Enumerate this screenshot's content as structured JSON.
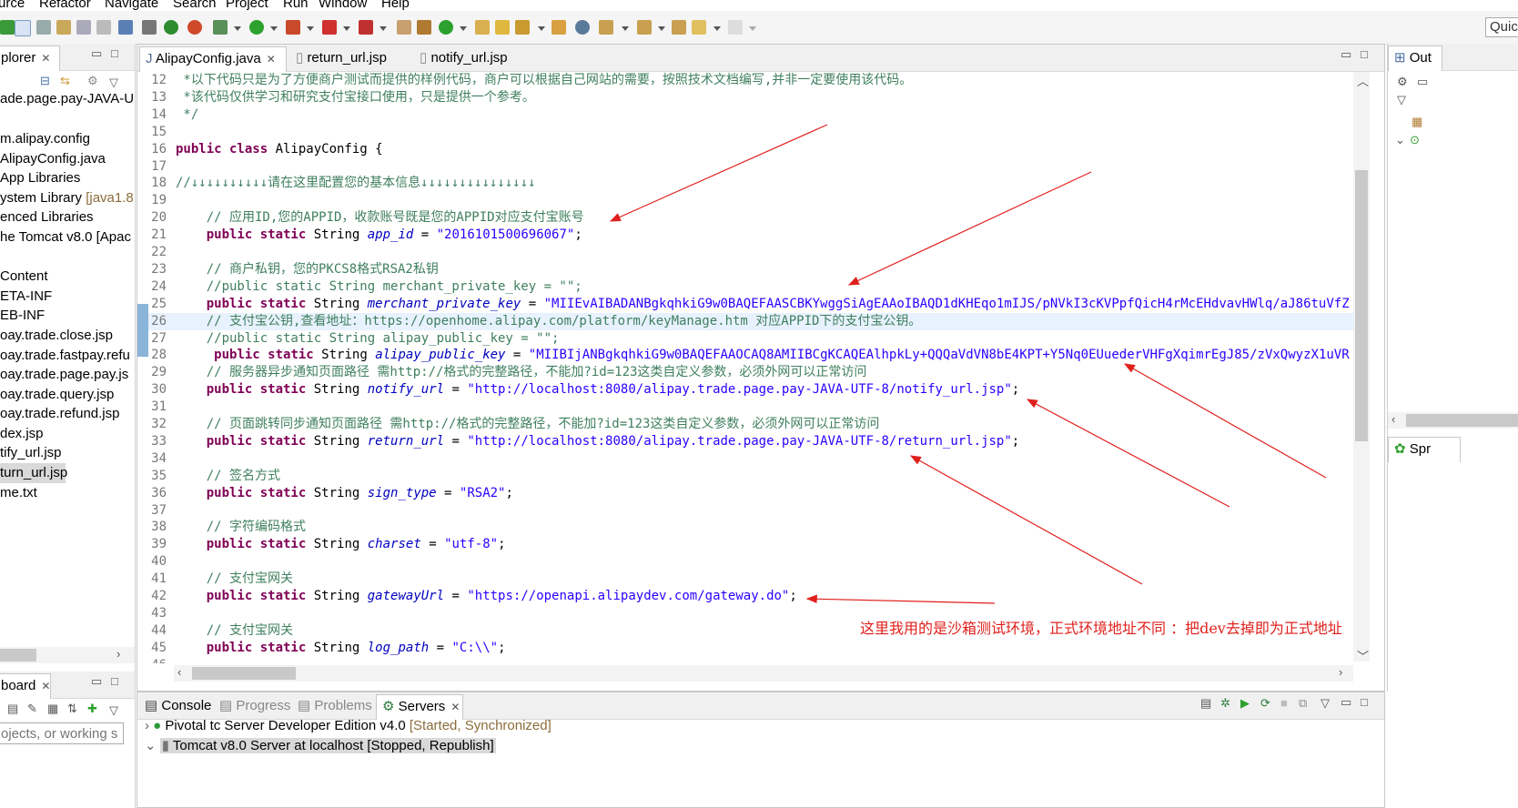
{
  "menu": [
    "urce",
    "Refactor",
    "Navigate",
    "Search",
    "Project",
    "Run",
    "Window",
    "Help"
  ],
  "toolbar": {
    "quick_access": "Quic"
  },
  "explorer": {
    "tab_label": "plorer",
    "items": [
      {
        "label": "ade.page.pay-JAVA-U",
        "decoration": ""
      },
      {
        "label": "m.alipay.config",
        "decoration": ""
      },
      {
        "label": "AlipayConfig.java",
        "decoration": ""
      },
      {
        "label": "App Libraries",
        "decoration": ""
      },
      {
        "label": "ystem Library",
        "decoration": " [java1.8"
      },
      {
        "label": "enced Libraries",
        "decoration": ""
      },
      {
        "label": "he Tomcat v8.0 [Apac",
        "decoration": ""
      },
      {
        "label": "Content",
        "decoration": ""
      },
      {
        "label": "ETA-INF",
        "decoration": ""
      },
      {
        "label": "EB-INF",
        "decoration": ""
      },
      {
        "label": "oay.trade.close.jsp",
        "decoration": ""
      },
      {
        "label": "oay.trade.fastpay.refu",
        "decoration": ""
      },
      {
        "label": "oay.trade.page.pay.js",
        "decoration": ""
      },
      {
        "label": "oay.trade.query.jsp",
        "decoration": ""
      },
      {
        "label": "oay.trade.refund.jsp",
        "decoration": ""
      },
      {
        "label": "dex.jsp",
        "decoration": ""
      },
      {
        "label": "tify_url.jsp",
        "decoration": ""
      },
      {
        "label": "turn_url.jsp",
        "decoration": ""
      },
      {
        "label": "me.txt",
        "decoration": ""
      }
    ]
  },
  "dashboard": {
    "tab_label": "board",
    "search_placeholder": "ojects, or working s"
  },
  "editor": {
    "tabs": [
      {
        "label": "AlipayConfig.java",
        "active": true
      },
      {
        "label": "return_url.jsp",
        "active": false
      },
      {
        "label": "notify_url.jsp",
        "active": false
      }
    ],
    "lines": [
      {
        "n": "12",
        "parts": [
          {
            "t": "cm",
            "s": " *以下代码只是为了方便商户测试而提供的样例代码，商户可以根据自己网站的需要，按照技术文档编写,并非一定要使用该代码。"
          }
        ]
      },
      {
        "n": "13",
        "parts": [
          {
            "t": "cm",
            "s": " *该代码仅供学习和研究支付宝接口使用，只是提供一个参考。"
          }
        ]
      },
      {
        "n": "14",
        "parts": [
          {
            "t": "cm",
            "s": " */"
          }
        ]
      },
      {
        "n": "15",
        "parts": []
      },
      {
        "n": "16",
        "parts": [
          {
            "t": "kw",
            "s": "public class "
          },
          {
            "t": "",
            "s": "AlipayConfig {"
          }
        ]
      },
      {
        "n": "17",
        "parts": []
      },
      {
        "n": "18",
        "parts": [
          {
            "t": "cm",
            "s": "//↓↓↓↓↓↓↓↓↓↓请在这里配置您的基本信息↓↓↓↓↓↓↓↓↓↓↓↓↓↓↓"
          }
        ]
      },
      {
        "n": "19",
        "parts": []
      },
      {
        "n": "20",
        "parts": [
          {
            "t": "cm",
            "s": "    // 应用ID,您的APPID，收款账号既是您的APPID对应支付宝账号"
          }
        ]
      },
      {
        "n": "21",
        "parts": [
          {
            "t": "",
            "s": "    "
          },
          {
            "t": "kw",
            "s": "public static "
          },
          {
            "t": "",
            "s": "String "
          },
          {
            "t": "fld",
            "s": "app_id"
          },
          {
            "t": "",
            "s": " = "
          },
          {
            "t": "st",
            "s": "\"2016101500696067\""
          },
          {
            "t": "",
            "s": ";"
          }
        ]
      },
      {
        "n": "22",
        "parts": []
      },
      {
        "n": "23",
        "parts": [
          {
            "t": "cm",
            "s": "    // 商户私钥，您的PKCS8格式RSA2私钥"
          }
        ]
      },
      {
        "n": "24",
        "parts": [
          {
            "t": "cm",
            "s": "    //public static String merchant_private_key = \"\";"
          }
        ]
      },
      {
        "n": "25",
        "parts": [
          {
            "t": "",
            "s": "    "
          },
          {
            "t": "kw",
            "s": "public static "
          },
          {
            "t": "",
            "s": "String "
          },
          {
            "t": "fld",
            "s": "merchant_private_key"
          },
          {
            "t": "",
            "s": " = "
          },
          {
            "t": "st",
            "s": "\"MIIEvAIBADANBgkqhkiG9w0BAQEFAASCBKYwggSiAgEAAoIBAQD1dKHEqo1mIJS/pNVkI3cKVPpfQicH4rMcEHdvavHWlq/aJ86tuVfZ"
          }
        ]
      },
      {
        "n": "26",
        "parts": [
          {
            "t": "cm",
            "s": "    // 支付宝公钥,查看地址：https://openhome.alipay.com/platform/keyManage.htm 对应APPID下的支付宝公钥。"
          }
        ]
      },
      {
        "n": "27",
        "parts": [
          {
            "t": "cm",
            "s": "    //public static String alipay_public_key = \"\";"
          }
        ]
      },
      {
        "n": "28",
        "parts": [
          {
            "t": "",
            "s": "     "
          },
          {
            "t": "kw",
            "s": "public static "
          },
          {
            "t": "",
            "s": "String "
          },
          {
            "t": "fld",
            "s": "alipay_public_key"
          },
          {
            "t": "",
            "s": " = "
          },
          {
            "t": "st",
            "s": "\"MIIBIjANBgkqhkiG9w0BAQEFAAOCAQ8AMIIBCgKCAQEAlhpkLy+QQQaVdVN8bE4KPT+Y5Nq0EUuederVHFgXqimrEgJ85/zVxQwyzX1uVR"
          }
        ]
      },
      {
        "n": "29",
        "parts": [
          {
            "t": "cm",
            "s": "    // 服务器异步通知页面路径 需http://格式的完整路径，不能加?id=123这类自定义参数，必须外网可以正常访问"
          }
        ]
      },
      {
        "n": "30",
        "parts": [
          {
            "t": "",
            "s": "    "
          },
          {
            "t": "kw",
            "s": "public static "
          },
          {
            "t": "",
            "s": "String "
          },
          {
            "t": "fld",
            "s": "notify_url"
          },
          {
            "t": "",
            "s": " = "
          },
          {
            "t": "st",
            "s": "\"http://localhost:8080/alipay.trade.page.pay-JAVA-UTF-8/notify_url.jsp\""
          },
          {
            "t": "",
            "s": ";"
          }
        ]
      },
      {
        "n": "31",
        "parts": []
      },
      {
        "n": "32",
        "parts": [
          {
            "t": "cm",
            "s": "    // 页面跳转同步通知页面路径 需http://格式的完整路径，不能加?id=123这类自定义参数，必须外网可以正常访问"
          }
        ]
      },
      {
        "n": "33",
        "parts": [
          {
            "t": "",
            "s": "    "
          },
          {
            "t": "kw",
            "s": "public static "
          },
          {
            "t": "",
            "s": "String "
          },
          {
            "t": "fld",
            "s": "return_url"
          },
          {
            "t": "",
            "s": " = "
          },
          {
            "t": "st",
            "s": "\"http://localhost:8080/alipay.trade.page.pay-JAVA-UTF-8/return_url.jsp\""
          },
          {
            "t": "",
            "s": ";"
          }
        ]
      },
      {
        "n": "34",
        "parts": []
      },
      {
        "n": "35",
        "parts": [
          {
            "t": "cm",
            "s": "    // 签名方式"
          }
        ]
      },
      {
        "n": "36",
        "parts": [
          {
            "t": "",
            "s": "    "
          },
          {
            "t": "kw",
            "s": "public static "
          },
          {
            "t": "",
            "s": "String "
          },
          {
            "t": "fld",
            "s": "sign_type"
          },
          {
            "t": "",
            "s": " = "
          },
          {
            "t": "st",
            "s": "\"RSA2\""
          },
          {
            "t": "",
            "s": ";"
          }
        ]
      },
      {
        "n": "37",
        "parts": []
      },
      {
        "n": "38",
        "parts": [
          {
            "t": "cm",
            "s": "    // 字符编码格式"
          }
        ]
      },
      {
        "n": "39",
        "parts": [
          {
            "t": "",
            "s": "    "
          },
          {
            "t": "kw",
            "s": "public static "
          },
          {
            "t": "",
            "s": "String "
          },
          {
            "t": "fld",
            "s": "charset"
          },
          {
            "t": "",
            "s": " = "
          },
          {
            "t": "st",
            "s": "\"utf-8\""
          },
          {
            "t": "",
            "s": ";"
          }
        ]
      },
      {
        "n": "40",
        "parts": []
      },
      {
        "n": "41",
        "parts": [
          {
            "t": "cm",
            "s": "    // 支付宝网关"
          }
        ]
      },
      {
        "n": "42",
        "parts": [
          {
            "t": "",
            "s": "    "
          },
          {
            "t": "kw",
            "s": "public static "
          },
          {
            "t": "",
            "s": "String "
          },
          {
            "t": "fld",
            "s": "gatewayUrl"
          },
          {
            "t": "",
            "s": " = "
          },
          {
            "t": "st",
            "s": "\"https://openapi.alipaydev.com/gateway.do\""
          },
          {
            "t": "",
            "s": ";"
          }
        ]
      },
      {
        "n": "43",
        "parts": []
      },
      {
        "n": "44",
        "parts": [
          {
            "t": "cm",
            "s": "    // 支付宝网关"
          }
        ]
      },
      {
        "n": "45",
        "parts": [
          {
            "t": "",
            "s": "    "
          },
          {
            "t": "kw",
            "s": "public static "
          },
          {
            "t": "",
            "s": "String "
          },
          {
            "t": "fld",
            "s": "log_path"
          },
          {
            "t": "",
            "s": " = "
          },
          {
            "t": "st",
            "s": "\"C:\\\\\""
          },
          {
            "t": "",
            "s": ";"
          }
        ]
      },
      {
        "n": "46",
        "parts": []
      }
    ],
    "annotation": "这里我用的是沙箱测试环境，正式环境地址不同 ：把dev去掉即为正式地址"
  },
  "outline": {
    "tab_label": "Out",
    "spring_label": "Spr"
  },
  "bottom": {
    "tabs": [
      "Console",
      "Progress",
      "Problems",
      "Servers"
    ],
    "servers": [
      {
        "name": "Pivotal tc Server Developer Edition v4.0",
        "status": " [Started, Synchronized]",
        "expanded": false,
        "selected": false
      },
      {
        "name": "Tomcat v8.0 Server at localhost",
        "status": " [Stopped, Republish]",
        "expanded": true,
        "selected": true
      }
    ]
  },
  "colors": {
    "keyword": "#7f0055",
    "comment": "#3f7f5f",
    "string": "#2a00ff",
    "field": "#0000c0",
    "annotation": "#e0201c"
  }
}
